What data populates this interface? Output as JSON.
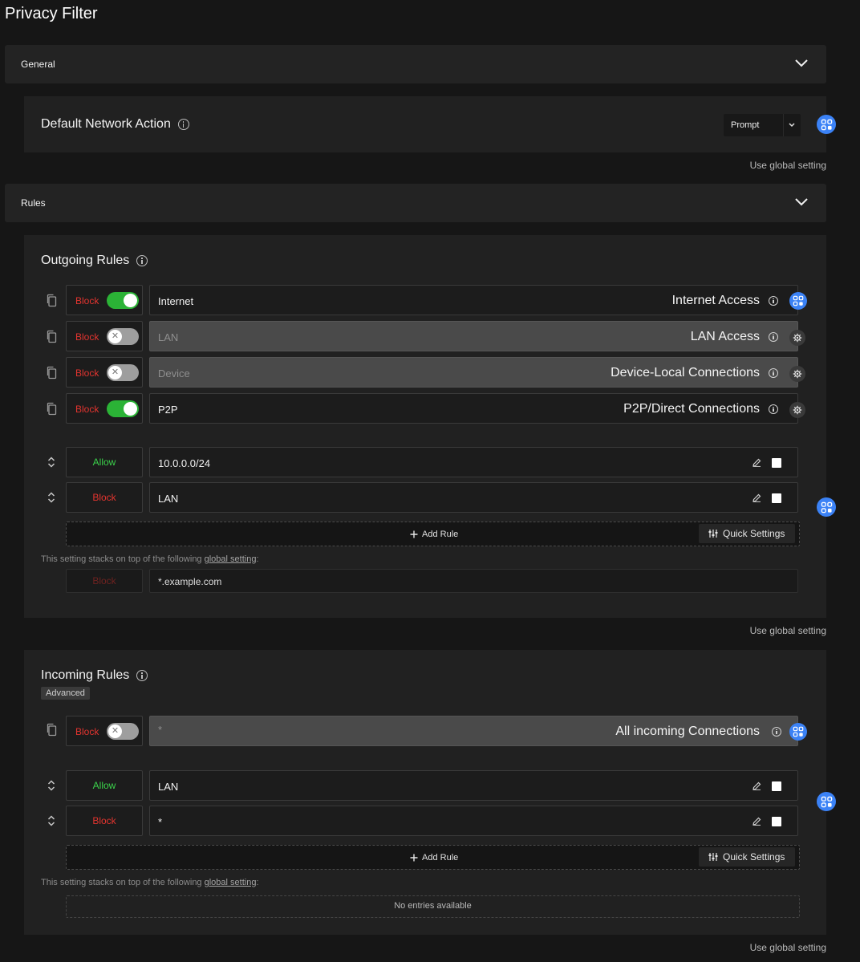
{
  "page": {
    "title": "Privacy Filter"
  },
  "sections": {
    "general": {
      "label": "General"
    },
    "rules": {
      "label": "Rules"
    }
  },
  "default_network_action": {
    "title": "Default Network Action",
    "select_value": "Prompt",
    "use_global": "Use global setting"
  },
  "outgoing": {
    "title": "Outgoing Rules",
    "quick_rules": [
      {
        "action": "Block",
        "enabled": true,
        "value": "Internet",
        "name": "Internet Access",
        "badge": "global"
      },
      {
        "action": "Block",
        "enabled": false,
        "value": "LAN",
        "name": "LAN Access",
        "badge": "gear"
      },
      {
        "action": "Block",
        "enabled": false,
        "value": "Device",
        "name": "Device-Local Connections",
        "badge": "gear"
      },
      {
        "action": "Block",
        "enabled": true,
        "value": "P2P",
        "name": "P2P/Direct Connections",
        "badge": "gear"
      }
    ],
    "entries": [
      {
        "verdict": "Allow",
        "value": "10.0.0.0/24"
      },
      {
        "verdict": "Block",
        "value": "LAN"
      }
    ],
    "add_rule": "Add Rule",
    "quick_settings": "Quick Settings",
    "stack_note_prefix": "This setting stacks on top of the following ",
    "stack_note_link": "global setting",
    "stack_note_suffix": ":",
    "global_entry": {
      "verdict": "Block",
      "value": "*.example.com"
    },
    "use_global": "Use global setting"
  },
  "incoming": {
    "title": "Incoming Rules",
    "tag": "Advanced",
    "quick_rules": [
      {
        "action": "Block",
        "enabled": false,
        "value": "*",
        "name": "All incoming Connections",
        "badge": "global"
      }
    ],
    "entries": [
      {
        "verdict": "Allow",
        "value": "LAN"
      },
      {
        "verdict": "Block",
        "value": "*"
      }
    ],
    "add_rule": "Add Rule",
    "quick_settings": "Quick Settings",
    "stack_note_prefix": "This setting stacks on top of the following ",
    "stack_note_link": "global setting",
    "stack_note_suffix": ":",
    "no_entries": "No entries available",
    "use_global": "Use global setting"
  },
  "colors": {
    "accent_blue": "#3b82f6",
    "allow_green": "#3bd24b",
    "block_red": "#e3342f",
    "toggle_on": "#2bb336"
  }
}
